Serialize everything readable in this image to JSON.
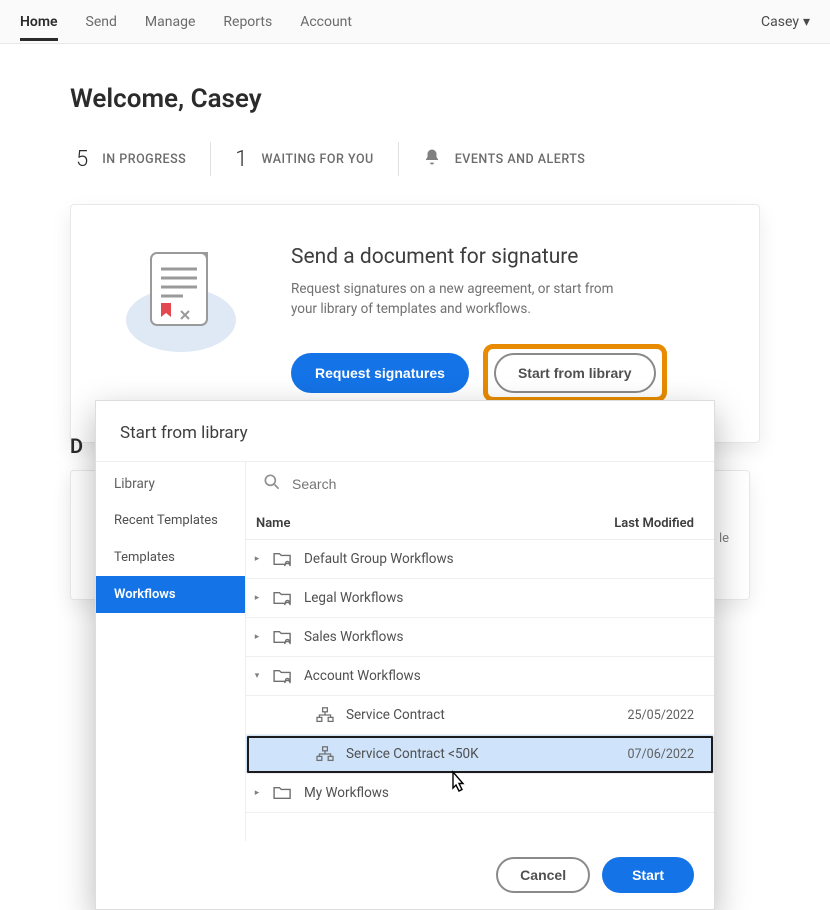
{
  "nav": {
    "items": [
      "Home",
      "Send",
      "Manage",
      "Reports",
      "Account"
    ],
    "active": 0,
    "user": "Casey"
  },
  "welcome": "Welcome, Casey",
  "status": {
    "in_progress": {
      "count": "5",
      "label": "IN PROGRESS"
    },
    "waiting": {
      "count": "1",
      "label": "WAITING FOR YOU"
    },
    "events": {
      "label": "EVENTS AND ALERTS"
    }
  },
  "hero": {
    "title": "Send a document for signature",
    "desc": "Request signatures on a new agreement, or start from your library of templates and workflows.",
    "request_btn": "Request signatures",
    "library_btn": "Start from library"
  },
  "truncated_heading_first_char": "D",
  "bg_fragment": "le",
  "modal": {
    "title": "Start from library",
    "search_placeholder": "Search",
    "sidebar": {
      "heading": "Library",
      "items": [
        "Recent Templates",
        "Templates",
        "Workflows"
      ],
      "selected": 2
    },
    "columns": {
      "name": "Name",
      "modified": "Last Modified"
    },
    "rows": [
      {
        "expand": "▸",
        "icon": "folder-shared",
        "label": "Default Group Workflows",
        "date": "",
        "indent": 0,
        "selected": false
      },
      {
        "expand": "▸",
        "icon": "folder-shared",
        "label": "Legal Workflows",
        "date": "",
        "indent": 0,
        "selected": false
      },
      {
        "expand": "▸",
        "icon": "folder-shared",
        "label": "Sales Workflows",
        "date": "",
        "indent": 0,
        "selected": false
      },
      {
        "expand": "▾",
        "icon": "folder-shared",
        "label": "Account Workflows",
        "date": "",
        "indent": 0,
        "selected": false
      },
      {
        "expand": "",
        "icon": "workflow",
        "label": "Service Contract",
        "date": "25/05/2022",
        "indent": 1,
        "selected": false
      },
      {
        "expand": "",
        "icon": "workflow",
        "label": "Service Contract <50K",
        "date": "07/06/2022",
        "indent": 1,
        "selected": true
      },
      {
        "expand": "▸",
        "icon": "folder",
        "label": "My Workflows",
        "date": "",
        "indent": 0,
        "selected": false
      }
    ],
    "cancel": "Cancel",
    "start": "Start"
  }
}
